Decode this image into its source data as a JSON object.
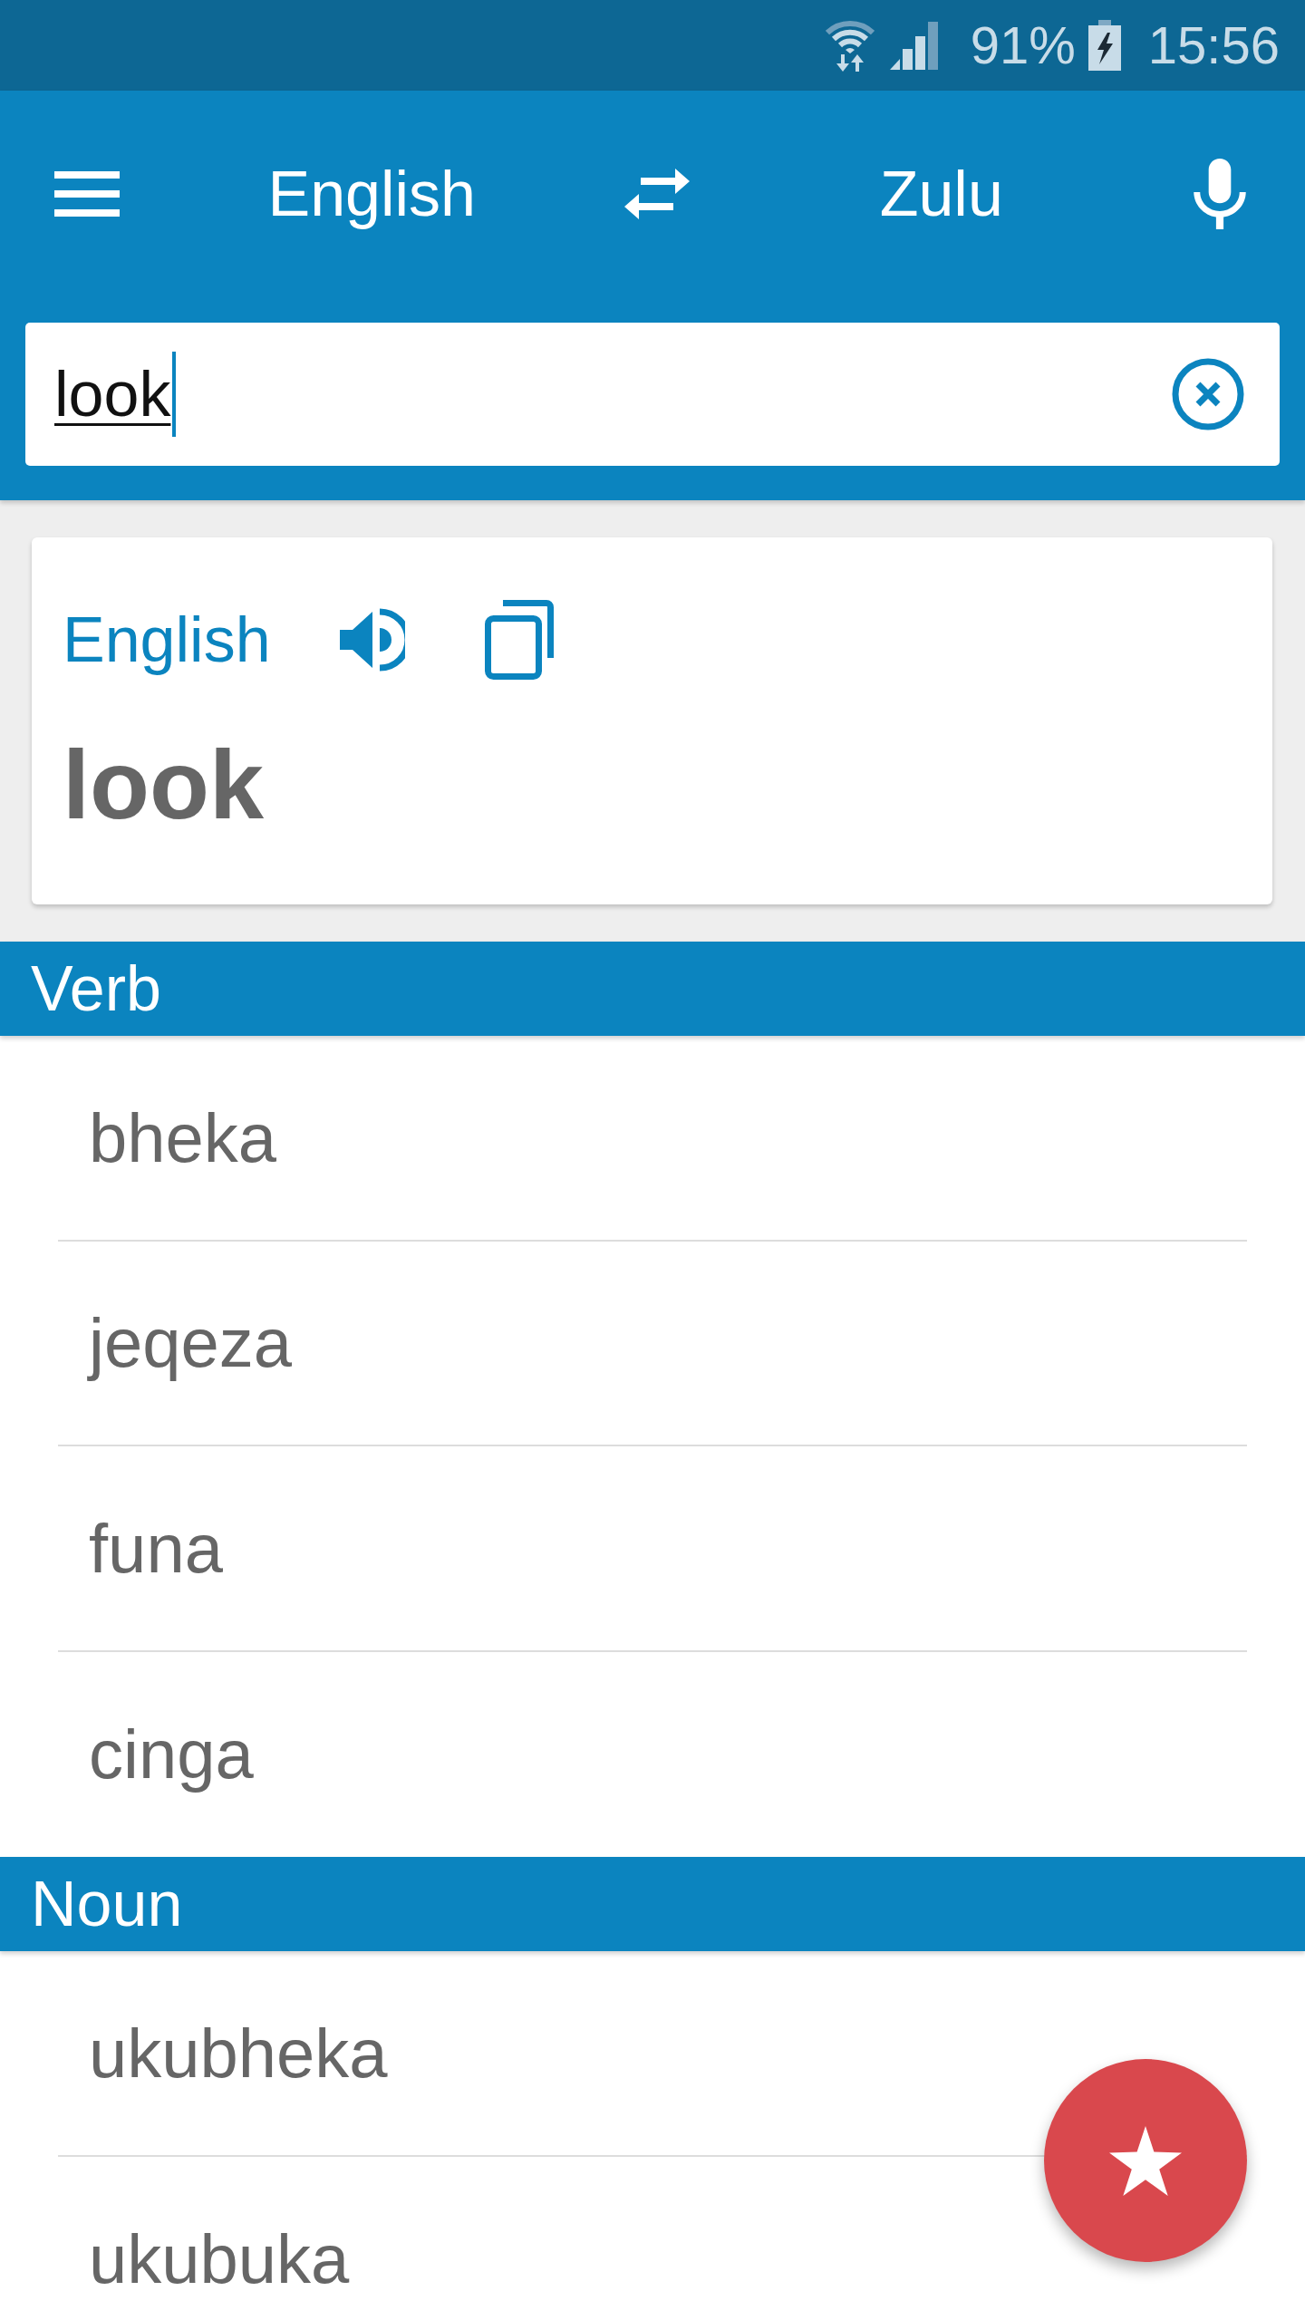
{
  "status_bar": {
    "battery": "91%",
    "time": "15:56"
  },
  "toolbar": {
    "source_language": "English",
    "target_language": "Zulu"
  },
  "search": {
    "value": "look"
  },
  "result_card": {
    "language": "English",
    "term": "look"
  },
  "sections": [
    {
      "label": "Verb",
      "entries": [
        "bheka",
        "jeqeza",
        "funa",
        "cinga"
      ]
    },
    {
      "label": "Noun",
      "entries": [
        "ukubheka",
        "ukubuka"
      ]
    }
  ]
}
